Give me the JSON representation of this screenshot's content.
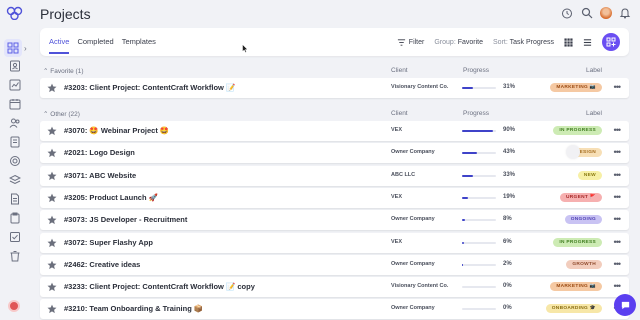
{
  "app": {
    "page_title": "Projects"
  },
  "tabs": [
    {
      "label": "Active",
      "active": true
    },
    {
      "label": "Completed",
      "active": false
    },
    {
      "label": "Templates",
      "active": false
    }
  ],
  "toolbar": {
    "filter_label": "Filter",
    "group_prefix": "Group:",
    "group_value": "Favorite",
    "sort_prefix": "Sort:",
    "sort_value": "Task Progress"
  },
  "columns": {
    "client": "Client",
    "progress": "Progress",
    "label": "Label"
  },
  "groups": [
    {
      "title": "Favorite (1)"
    },
    {
      "title": "Other (22)"
    }
  ],
  "rows": [
    {
      "title": "#3203: Client Project: ContentCraft Workflow 📝",
      "client": "Visionary Content Co.",
      "progress": 31,
      "progress_text": "31%",
      "label": "MARKETING 📷",
      "label_bg": "#f5c9a3",
      "label_fg": "#9a4a12",
      "starred": true
    },
    {
      "title": "#3070: 🤩 Webinar Project 🤩",
      "client": "VEX",
      "progress": 90,
      "progress_text": "90%",
      "label": "IN PROGRESS",
      "label_bg": "#cdebb4",
      "label_fg": "#3f7d1f",
      "starred": false
    },
    {
      "title": "#2021: Logo Design",
      "client": "Owner Company",
      "progress": 43,
      "progress_text": "43%",
      "label": "DESIGN",
      "label_bg": "#f7dfb6",
      "label_fg": "#a36a1a",
      "starred": false
    },
    {
      "title": "#3071: ABC Website",
      "client": "ABC LLC",
      "progress": 33,
      "progress_text": "33%",
      "label": "NEW",
      "label_bg": "#f7f0a6",
      "label_fg": "#8a7a10",
      "starred": false
    },
    {
      "title": "#3205: Product Launch 🚀",
      "client": "VEX",
      "progress": 19,
      "progress_text": "19%",
      "label": "URGENT 🚩",
      "label_bg": "#f6b0b0",
      "label_fg": "#a52828",
      "starred": false
    },
    {
      "title": "#3073: JS Developer - Recruitment",
      "client": "Owner Company",
      "progress": 8,
      "progress_text": "8%",
      "label": "ONGOING",
      "label_bg": "#c9c3f3",
      "label_fg": "#4e3fb3",
      "starred": false
    },
    {
      "title": "#3072: Super Flashy App",
      "client": "VEX",
      "progress": 6,
      "progress_text": "6%",
      "label": "IN PROGRESS",
      "label_bg": "#cdebb4",
      "label_fg": "#3f7d1f",
      "starred": false
    },
    {
      "title": "#2462: Creative ideas",
      "client": "Owner Company",
      "progress": 2,
      "progress_text": "2%",
      "label": "GROWTH",
      "label_bg": "#f2cdbd",
      "label_fg": "#8f4a2c",
      "starred": false
    },
    {
      "title": "#3233: Client Project: ContentCraft Workflow 📝 copy",
      "client": "Visionary Content Co.",
      "progress": 0,
      "progress_text": "0%",
      "label": "MARKETING 📷",
      "label_bg": "#f5c9a3",
      "label_fg": "#9a4a12",
      "starred": false
    },
    {
      "title": "#3210: Team Onboarding & Training 📦",
      "client": "Owner Company",
      "progress": 0,
      "progress_text": "0%",
      "label": "ONBOARDING 🎓",
      "label_bg": "#f7e7a8",
      "label_fg": "#8a6d10",
      "starred": false
    }
  ],
  "icons": {
    "sidebar": [
      "dashboard-icon",
      "contacts-icon",
      "chart-icon",
      "calendar-icon",
      "users-icon",
      "invoice-icon",
      "target-icon",
      "layers-icon",
      "document-icon",
      "clipboard-icon",
      "checklist-icon",
      "trash-icon"
    ],
    "top": [
      "timer-icon",
      "search-icon",
      "avatar",
      "bell-icon"
    ]
  },
  "colors": {
    "accent": "#4f52d9",
    "primary_button": "#6a4ef2",
    "progress_fill": "#3f43c9"
  }
}
